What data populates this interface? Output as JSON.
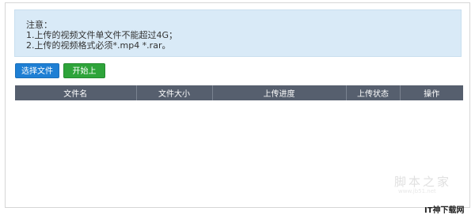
{
  "notice": {
    "title": "注意：",
    "lines": [
      "1.上传的视频文件单文件不能超过4G；",
      "2.上传的视频格式必须*.mp4 *.rar。"
    ]
  },
  "toolbar": {
    "select_label": "选择文件",
    "start_label": "开始上传"
  },
  "table": {
    "columns": [
      "文件名",
      "文件大小",
      "上传进度",
      "上传状态",
      "操作"
    ],
    "rows": []
  },
  "watermark": {
    "text": "脚本之家",
    "url": "www.jb51.net",
    "logo": "IT神下载网"
  },
  "colors": {
    "notice_bg": "#d9eaf7",
    "select_button": "#1e7fd4",
    "start_button": "#2ea43a",
    "table_header": "#565f6e"
  }
}
